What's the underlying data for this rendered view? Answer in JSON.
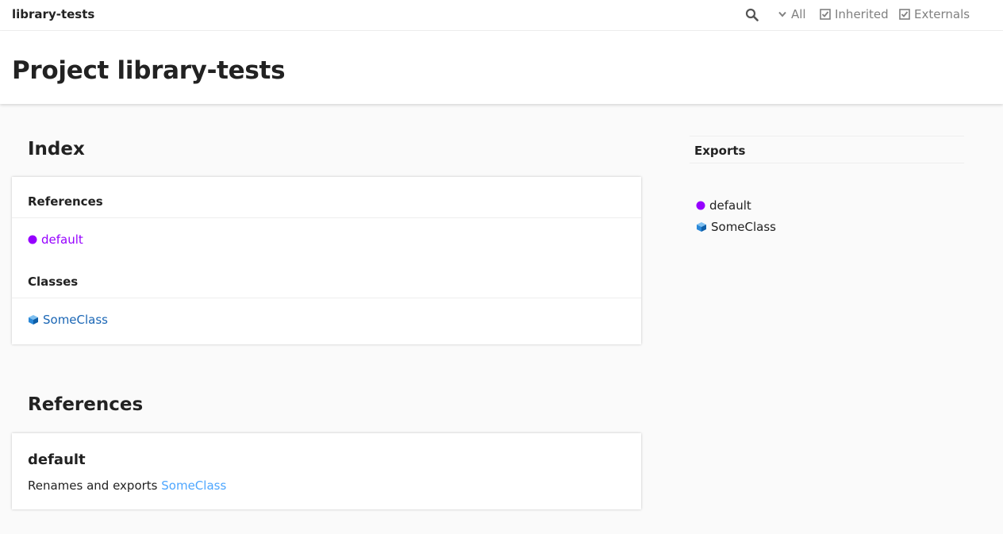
{
  "toolbar": {
    "title": "library-tests",
    "search_icon": "search-icon",
    "visibility_label": "All",
    "inherited_label": "Inherited",
    "externals_label": "Externals"
  },
  "page": {
    "title": "Project library-tests"
  },
  "index": {
    "heading": "Index",
    "groups": [
      {
        "title": "References",
        "items": [
          {
            "label": "default",
            "kind": "reference",
            "icon": "reference-dot-icon",
            "color": "#9600ff"
          }
        ]
      },
      {
        "title": "Classes",
        "items": [
          {
            "label": "SomeClass",
            "kind": "class",
            "icon": "class-cube-icon",
            "color": "#1a66b5"
          }
        ]
      }
    ]
  },
  "references": {
    "heading": "References",
    "members": [
      {
        "name": "default",
        "desc_prefix": "Renames and exports ",
        "desc_link": "SomeClass"
      }
    ]
  },
  "sidebar": {
    "title": "Exports",
    "items": [
      {
        "label": "default",
        "icon": "reference-dot-icon"
      },
      {
        "label": "SomeClass",
        "icon": "class-cube-icon"
      }
    ]
  },
  "colors": {
    "reference": "#9600ff",
    "class_link": "#1a66b5",
    "inline_link": "#4da6ff",
    "muted": "#808080"
  }
}
